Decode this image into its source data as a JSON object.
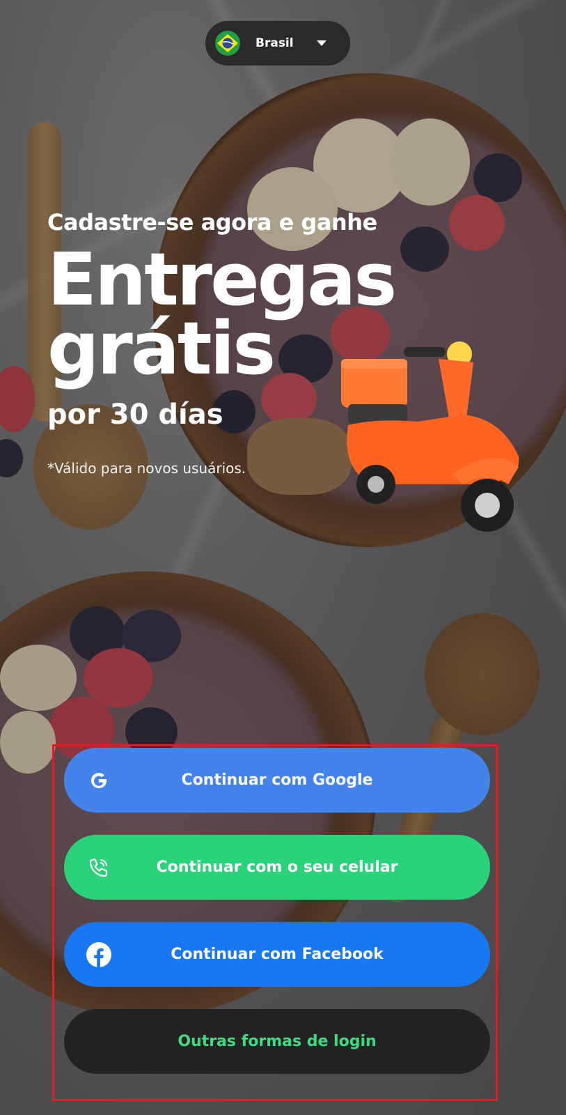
{
  "country_selector": {
    "label": "Brasil",
    "flag_icon": "brazil-flag-icon",
    "chevron_icon": "chevron-down-icon"
  },
  "promo": {
    "subtitle": "Cadastre-se agora e ganhe",
    "headline_line1": "Entregas",
    "headline_line2": "grátis",
    "duration": "por 30 días",
    "disclaimer": "*Válido para novos usuários."
  },
  "auth": {
    "google_label": "Continuar com Google",
    "phone_label": "Continuar com o seu celular",
    "facebook_label": "Continuar com Facebook",
    "others_label": "Outras formas de login"
  },
  "colors": {
    "google": "#4483ea",
    "phone": "#2ad27a",
    "facebook": "#1877f2",
    "others_bg": "#232323",
    "others_text": "#3ddc84",
    "highlight": "#e21b24"
  }
}
